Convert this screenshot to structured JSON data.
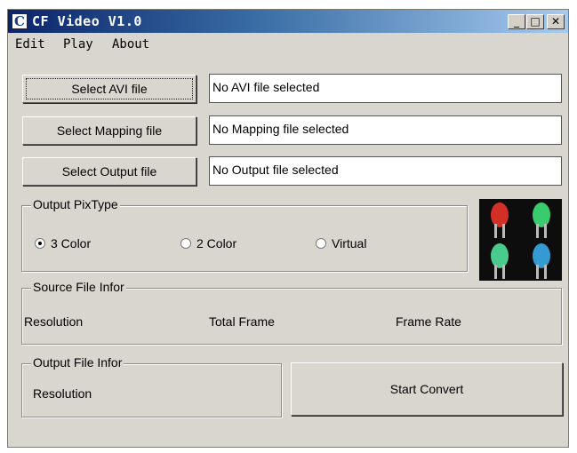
{
  "window": {
    "title": "CF Video V1.0",
    "controls": {
      "minimize": "_",
      "maximize": "□",
      "close": "✕"
    }
  },
  "menu": [
    "Edit",
    "Play",
    "About"
  ],
  "files": [
    {
      "button": "Select AVI file",
      "status": "No AVI file selected"
    },
    {
      "button": "Select Mapping file",
      "status": "No Mapping file selected"
    },
    {
      "button": "Select Output file",
      "status": "No Output file selected"
    }
  ],
  "pixtype": {
    "legend": "Output PixType",
    "options": [
      "3 Color",
      "2 Color",
      "Virtual"
    ],
    "selected": "3 Color"
  },
  "source_info": {
    "legend": "Source File Infor",
    "labels": [
      "Resolution",
      "Total Frame",
      "Frame Rate"
    ]
  },
  "output_info": {
    "legend": "Output File Infor",
    "labels": [
      "Resolution"
    ]
  },
  "actions": {
    "start_convert": "Start Convert"
  },
  "led_preview": {
    "icon_names": [
      "red-led-icon",
      "green-led-icon",
      "green-led-icon",
      "blue-led-icon"
    ],
    "colors": [
      "#e8342a",
      "#3fe07a",
      "#4fe09a",
      "#3aa8e8"
    ]
  }
}
